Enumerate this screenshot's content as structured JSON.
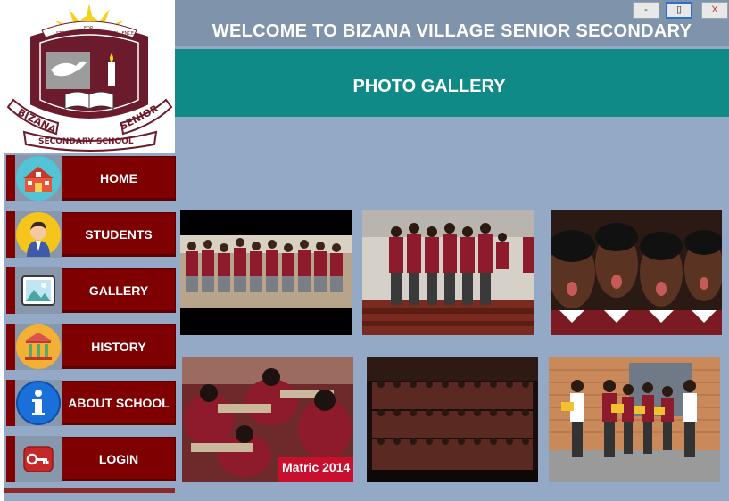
{
  "window": {
    "minimize_label": "-",
    "maximize_label": "▯",
    "close_label": "X"
  },
  "header": {
    "title": "WELCOME TO BIZANA VILLAGE SENIOR SECONDARY"
  },
  "page": {
    "title": "PHOTO GALLERY"
  },
  "logo": {
    "motto_left": "STRIVE",
    "motto_mid": "FOR",
    "motto_right": "EXCELLENCE",
    "name_left": "BIZANA",
    "name_right": "SENIOR",
    "bottom": "SECONDARY SCHOOL"
  },
  "nav": {
    "items": [
      {
        "label": "HOME",
        "icon": "school-icon"
      },
      {
        "label": "STUDENTS",
        "icon": "student-icon"
      },
      {
        "label": "GALLERY",
        "icon": "image-icon"
      },
      {
        "label": "HISTORY",
        "icon": "museum-icon"
      },
      {
        "label": "ABOUT SCHOOL",
        "icon": "info-icon"
      },
      {
        "label": "LOGIN",
        "icon": "key-icon"
      }
    ]
  },
  "gallery": {
    "photos": [
      {
        "name": "students-dancing-photo"
      },
      {
        "name": "choir-on-stage-photo"
      },
      {
        "name": "girls-singing-photo"
      },
      {
        "name": "students-writing-exam-photo",
        "caption": "Matric 2014"
      },
      {
        "name": "large-choir-photo"
      },
      {
        "name": "students-with-awards-photo"
      }
    ]
  },
  "colors": {
    "maroon": "#7e0000",
    "teal": "#0f8a87",
    "panel": "#94a9c6",
    "topbar": "#7f94ab"
  }
}
